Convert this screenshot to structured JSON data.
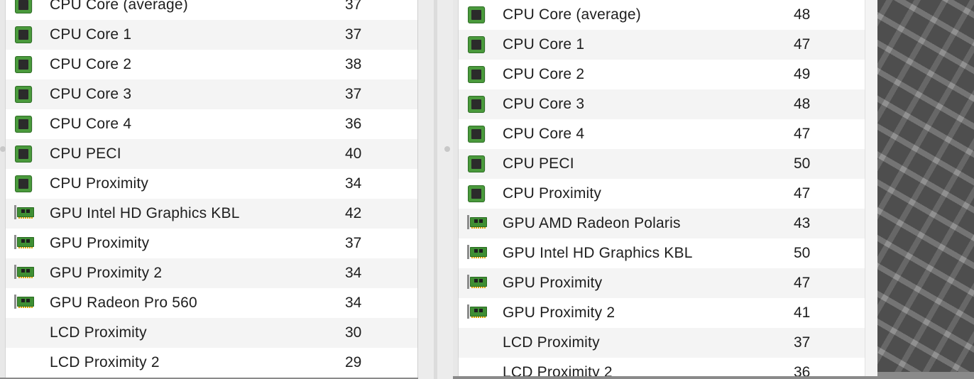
{
  "left_panel": {
    "rows": [
      {
        "icon": "cpu-chip-icon",
        "name": "CPU Core (average)",
        "value": "37"
      },
      {
        "icon": "cpu-chip-icon",
        "name": "CPU Core 1",
        "value": "37"
      },
      {
        "icon": "cpu-chip-icon",
        "name": "CPU Core 2",
        "value": "38"
      },
      {
        "icon": "cpu-chip-icon",
        "name": "CPU Core 3",
        "value": "37"
      },
      {
        "icon": "cpu-chip-icon",
        "name": "CPU Core 4",
        "value": "36"
      },
      {
        "icon": "cpu-chip-icon",
        "name": "CPU PECI",
        "value": "40"
      },
      {
        "icon": "cpu-chip-icon",
        "name": "CPU Proximity",
        "value": "34"
      },
      {
        "icon": "gpu-card-icon",
        "name": "GPU Intel HD Graphics KBL",
        "value": "42"
      },
      {
        "icon": "gpu-card-icon",
        "name": "GPU Proximity",
        "value": "37"
      },
      {
        "icon": "gpu-card-icon",
        "name": "GPU Proximity 2",
        "value": "34"
      },
      {
        "icon": "gpu-card-icon",
        "name": "GPU Radeon Pro 560",
        "value": "34"
      },
      {
        "icon": "",
        "name": "LCD Proximity",
        "value": "30"
      },
      {
        "icon": "",
        "name": "LCD Proximity 2",
        "value": "29"
      }
    ]
  },
  "right_panel": {
    "rows": [
      {
        "icon": "cpu-chip-icon",
        "name": "CPU Core (average)",
        "value": "48"
      },
      {
        "icon": "cpu-chip-icon",
        "name": "CPU Core 1",
        "value": "47"
      },
      {
        "icon": "cpu-chip-icon",
        "name": "CPU Core 2",
        "value": "49"
      },
      {
        "icon": "cpu-chip-icon",
        "name": "CPU Core 3",
        "value": "48"
      },
      {
        "icon": "cpu-chip-icon",
        "name": "CPU Core 4",
        "value": "47"
      },
      {
        "icon": "cpu-chip-icon",
        "name": "CPU PECI",
        "value": "50"
      },
      {
        "icon": "cpu-chip-icon",
        "name": "CPU Proximity",
        "value": "47"
      },
      {
        "icon": "gpu-card-icon",
        "name": "GPU AMD Radeon Polaris",
        "value": "43"
      },
      {
        "icon": "gpu-card-icon",
        "name": "GPU Intel HD Graphics KBL",
        "value": "50"
      },
      {
        "icon": "gpu-card-icon",
        "name": "GPU Proximity",
        "value": "47"
      },
      {
        "icon": "gpu-card-icon",
        "name": "GPU Proximity 2",
        "value": "41"
      },
      {
        "icon": "",
        "name": "LCD Proximity",
        "value": "37"
      },
      {
        "icon": "",
        "name": "LCD Proximity 2",
        "value": "36"
      }
    ]
  },
  "colors": {
    "row_alt": "#f4f4f4",
    "chip_green": "#4a9a3c",
    "text": "#1e1e1e"
  }
}
